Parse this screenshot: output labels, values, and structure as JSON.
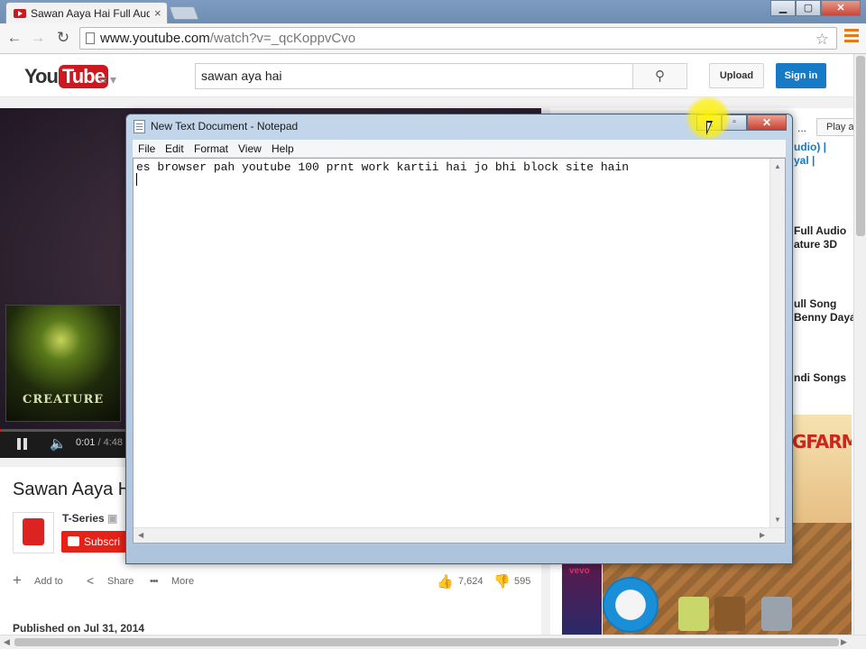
{
  "browser": {
    "tab_title": "Sawan Aaya Hai Full Audio",
    "tab_close": "×",
    "url_host": "www.youtube.com",
    "url_path": "/watch?v=_qcKoppvCvo",
    "window_minimize": "▁",
    "window_maximize": "▢",
    "window_close": "✕",
    "back": "←",
    "forward": "→",
    "reload": "↻",
    "star": "☆"
  },
  "youtube": {
    "logo_you": "You",
    "logo_tube": "Tube",
    "guide": "≡ ▾",
    "search_value": "sawan aya hai",
    "search_icon_glyph": "⚲",
    "upload_label": "Upload",
    "signin_label": "Sign in"
  },
  "player": {
    "poster_title": "CREATURE",
    "progress_fraction": 0.0035,
    "time_current": "0:01",
    "time_separator": " / ",
    "time_duration": "4:48",
    "volume_glyph": "🔈"
  },
  "watch": {
    "title": "Sawan Aaya H",
    "channel_name": "T-Series",
    "verified_glyph": "▣",
    "subscribe_label": "Subscri",
    "add_to_label": "Add to",
    "share_label": "Share",
    "more_label": "More",
    "add_glyph": "+",
    "share_glyph": "<",
    "more_glyph": "•••",
    "like_glyph": "👍",
    "dislike_glyph": "👎",
    "likes": "7,624",
    "dislikes": "595",
    "published": "Published on Jul 31, 2014"
  },
  "sidebar": {
    "playall_label": "Play a",
    "ellipsis": "...",
    "items": [
      {
        "text": "udio) |"
      },
      {
        "text": "yal |"
      },
      {
        "text": "Full Audio"
      },
      {
        "text": "ature 3D"
      },
      {
        "text": "ull Song"
      },
      {
        "text": "Benny Daya"
      },
      {
        "text": "ndi Songs"
      }
    ],
    "ad_text": "GFARM",
    "vevo_label": "vevo"
  },
  "notepad": {
    "title": "New Text Document - Notepad",
    "menu": [
      "File",
      "Edit",
      "Format",
      "View",
      "Help"
    ],
    "content": "es browser pah youtube 100 prnt work kartii hai jo bhi block site hain",
    "minimize": "▁",
    "maximize": "▫",
    "close": "✕",
    "arrow_up": "▲",
    "arrow_down": "▼",
    "arrow_left": "◀",
    "arrow_right": "▶"
  },
  "colors": {
    "youtube_red": "#cc181e",
    "signin_blue": "#167ac6",
    "subscribe_red": "#e62117",
    "cursor_highlight": "#fff200"
  }
}
